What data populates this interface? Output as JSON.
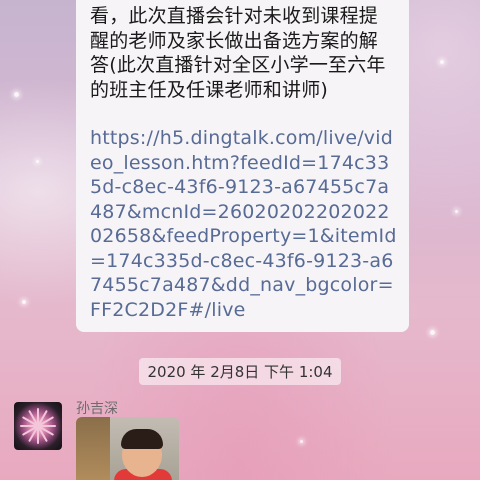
{
  "conversation": {
    "message_text": "看，此次直播会针对未收到课程提醒的老师及家长做出备选方案的解答(此次直播针对全区小学一至六年的班主任及任课老师和讲师)",
    "message_link": "https://h5.dingtalk.com/live/video_lesson.htm?feedId=174c335d-c8ec-43f6-9123-a67455c7a487&mcnId=2602020220202202658&feedProperty=1&itemId=174c335d-c8ec-43f6-9123-a67455c7a487&dd_nav_bgcolor=FF2C2D2F#/live",
    "timestamp": "2020 年 2月8日 下午 1:04",
    "next_message": {
      "sender_name": "孙吉深"
    }
  },
  "colors": {
    "link": "#576b95",
    "bubble": "#f7f4f7"
  }
}
